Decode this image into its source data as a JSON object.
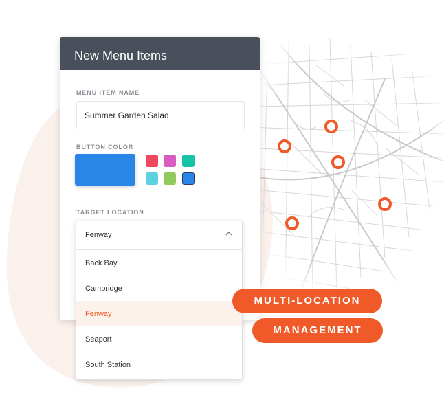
{
  "card": {
    "title": "New Menu Items",
    "name_label": "MENU ITEM NAME",
    "name_value": "Summer Garden Salad",
    "color_label": "BUTTON COLOR",
    "location_label": "TARGET LOCATION"
  },
  "colors": {
    "selected": "#2a86e6",
    "swatches": [
      "#f04760",
      "#d85cc1",
      "#16c3a6",
      "#5cd2e0",
      "#92c95c",
      "#2a86e6"
    ],
    "accent": "#f05a28",
    "header": "#4a4f5c"
  },
  "dropdown": {
    "selected": "Fenway",
    "options": [
      "Back Bay",
      "Cambridge",
      "Fenway",
      "Seaport",
      "South Station"
    ],
    "active_index": 2
  },
  "badges": {
    "line1": "MULTI-LOCATION",
    "line2": "MANAGEMENT"
  },
  "icons": {
    "chevron": "chevron-up-icon",
    "pin": "map-pin-icon"
  }
}
